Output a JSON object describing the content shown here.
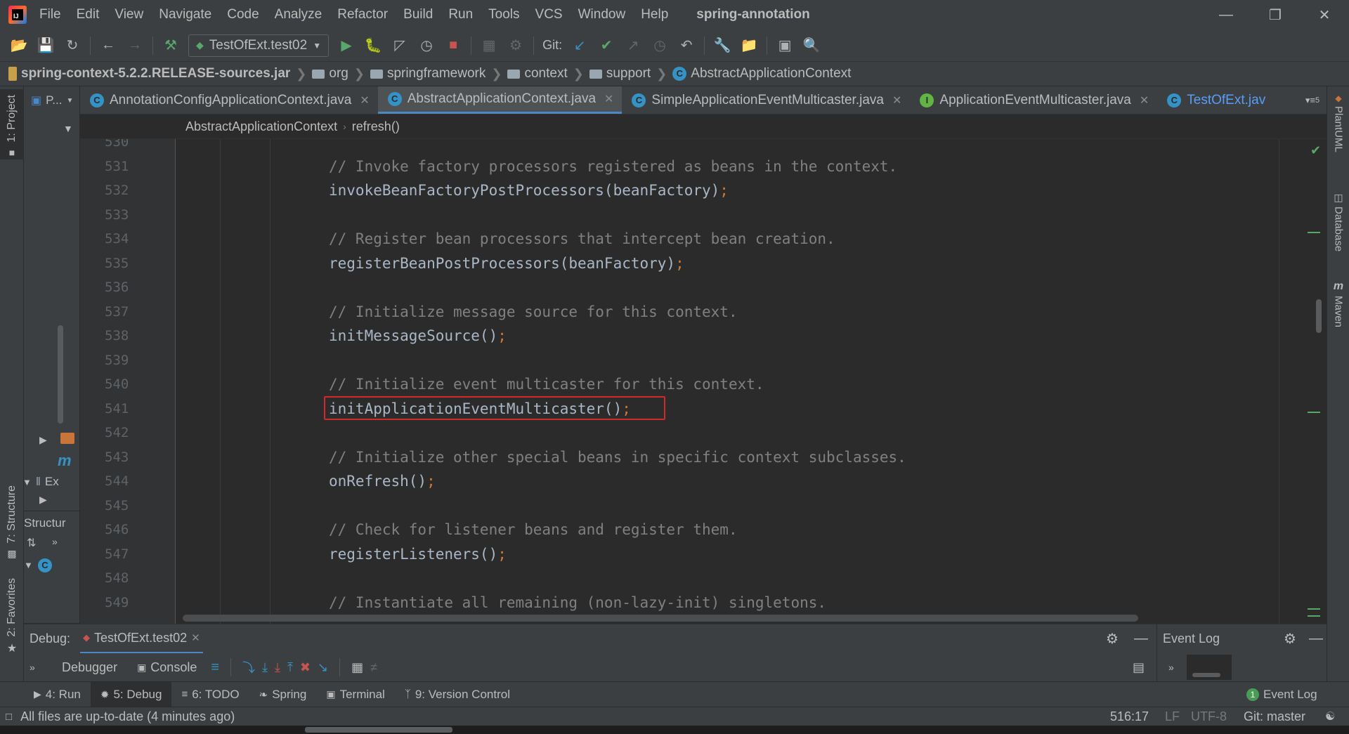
{
  "app": {
    "project_title": "spring-annotation",
    "menu": [
      "File",
      "Edit",
      "View",
      "Navigate",
      "Code",
      "Analyze",
      "Refactor",
      "Build",
      "Run",
      "Tools",
      "VCS",
      "Window",
      "Help"
    ]
  },
  "toolbar": {
    "run_config": "TestOfExt.test02",
    "git_label": "Git:"
  },
  "navbar": {
    "crumbs": [
      "spring-context-5.2.2.RELEASE-sources.jar",
      "org",
      "springframework",
      "context",
      "support",
      "AbstractApplicationContext"
    ]
  },
  "project_panel": {
    "title": "P...",
    "items": [
      "Ex",
      "Structur"
    ]
  },
  "tabs": [
    {
      "label": "AnnotationConfigApplicationContext.java",
      "active": false
    },
    {
      "label": "AbstractApplicationContext.java",
      "active": true
    },
    {
      "label": "SimpleApplicationEventMulticaster.java",
      "active": false
    },
    {
      "label": "ApplicationEventMulticaster.java",
      "active": false
    },
    {
      "label": "TestOfExt.jav",
      "active": false
    }
  ],
  "tabs_overflow": "5",
  "editor_crumbs": [
    "AbstractApplicationContext",
    "refresh()"
  ],
  "code": {
    "lines": [
      {
        "n": "530",
        "kind": "blank",
        "text": ""
      },
      {
        "n": "531",
        "kind": "comment",
        "text": "// Invoke factory processors registered as beans in the context."
      },
      {
        "n": "532",
        "kind": "call",
        "text": "invokeBeanFactoryPostProcessors(beanFactory)"
      },
      {
        "n": "533",
        "kind": "blank",
        "text": ""
      },
      {
        "n": "534",
        "kind": "comment",
        "text": "// Register bean processors that intercept bean creation."
      },
      {
        "n": "535",
        "kind": "call",
        "text": "registerBeanPostProcessors(beanFactory)"
      },
      {
        "n": "536",
        "kind": "blank",
        "text": ""
      },
      {
        "n": "537",
        "kind": "comment",
        "text": "// Initialize message source for this context."
      },
      {
        "n": "538",
        "kind": "call",
        "text": "initMessageSource()"
      },
      {
        "n": "539",
        "kind": "blank",
        "text": ""
      },
      {
        "n": "540",
        "kind": "comment",
        "text": "// Initialize event multicaster for this context."
      },
      {
        "n": "541",
        "kind": "call",
        "text": "initApplicationEventMulticaster()"
      },
      {
        "n": "542",
        "kind": "blank",
        "text": ""
      },
      {
        "n": "543",
        "kind": "comment",
        "text": "// Initialize other special beans in specific context subclasses."
      },
      {
        "n": "544",
        "kind": "call",
        "text": "onRefresh()"
      },
      {
        "n": "545",
        "kind": "blank",
        "text": ""
      },
      {
        "n": "546",
        "kind": "comment",
        "text": "// Check for listener beans and register them."
      },
      {
        "n": "547",
        "kind": "call",
        "text": "registerListeners()"
      },
      {
        "n": "548",
        "kind": "blank",
        "text": ""
      },
      {
        "n": "549",
        "kind": "comment",
        "text": "// Instantiate all remaining (non-lazy-init) singletons."
      }
    ],
    "semicolon": ";",
    "highlighted_line": "541"
  },
  "left_strip": {
    "project": "1: Project",
    "structure": "7: Structure",
    "favorites": "2: Favorites"
  },
  "right_strip": {
    "plantuml": "PlantUML",
    "database": "Database",
    "maven": "Maven"
  },
  "debug": {
    "label": "Debug:",
    "session": "TestOfExt.test02",
    "tab_debugger": "Debugger",
    "tab_console": "Console"
  },
  "event_log": {
    "title": "Event Log"
  },
  "bottom_tabs": [
    {
      "label": "4: Run",
      "active": false
    },
    {
      "label": "5: Debug",
      "active": true
    },
    {
      "label": "6: TODO",
      "active": false
    },
    {
      "label": "Spring",
      "active": false
    },
    {
      "label": "Terminal",
      "active": false
    },
    {
      "label": "9: Version Control",
      "active": false
    }
  ],
  "bottom_right_tab": {
    "badge": "1",
    "label": "Event Log"
  },
  "status": {
    "message": "All files are up-to-date (4 minutes ago)",
    "position": "516:17",
    "line_sep": "LF",
    "encoding": "UTF-8",
    "git_branch": "Git: master"
  },
  "colors": {
    "comment": "#808080",
    "code": "#a9b7c6",
    "semicolon": "#cc7832",
    "highlight_box": "#d0282b",
    "active_tab_underline": "#4a88c7"
  }
}
